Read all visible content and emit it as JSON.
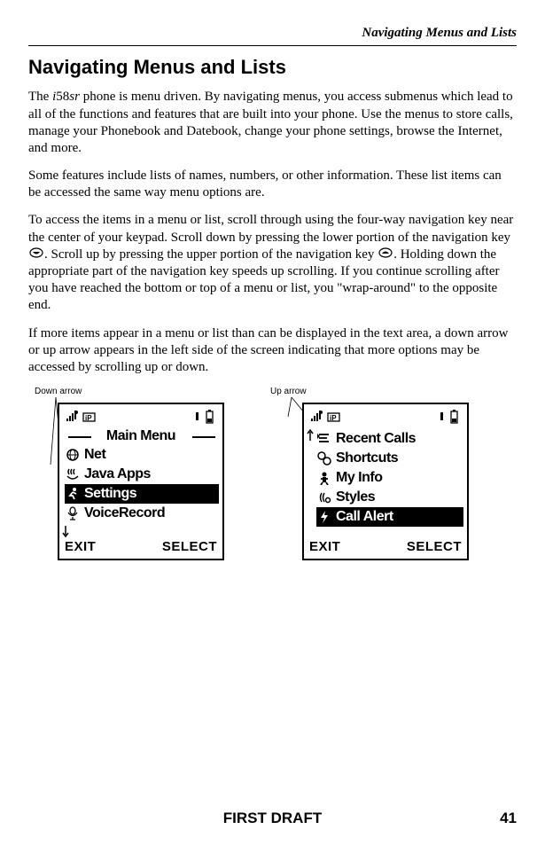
{
  "running_head": "Navigating Menus and Lists",
  "heading": "Navigating Menus and Lists",
  "para1_a": "The ",
  "para1_model": "i",
  "para1_model2": "58",
  "para1_model3": "sr",
  "para1_b": " phone is menu driven. By navigating menus, you access submenus which lead to all of the functions and features that are built into your phone. Use the menus to store calls, manage your Phonebook and Datebook, change your phone settings, browse the Internet, and more.",
  "para2": "Some features include lists of names, numbers, or other information. These list items can be accessed the same way menu options are.",
  "para3_a": "To access the items in a menu or list, scroll through using the four-way navigation key near the center of your keypad. Scroll down by pressing the lower portion of the navigation key ",
  "para3_b": ". Scroll up by pressing the upper portion of the navigation key ",
  "para3_c": ". Holding down the appropriate part of the navigation key speeds up scrolling. If you continue scrolling after you have reached the bottom or top of a menu or list, you \"wrap-around\" to the opposite end.",
  "para4": "If more items appear in a menu or list than can be displayed in the text area, a down arrow or up arrow appears in the left side of the screen indicating that more options may be accessed by scrolling up or down.",
  "fig1": {
    "label": "Down arrow",
    "title": "Main Menu",
    "items": [
      {
        "icon": "globe",
        "label": "Net",
        "selected": false
      },
      {
        "icon": "steam",
        "label": "Java Apps",
        "selected": false
      },
      {
        "icon": "runner",
        "label": "Settings",
        "selected": true
      },
      {
        "icon": "mic",
        "label": "VoiceRecord",
        "selected": false
      }
    ],
    "left_softkey": "EXIT",
    "right_softkey": "SELECT"
  },
  "fig2": {
    "label": "Up arrow",
    "items": [
      {
        "icon": "list",
        "label": "Recent Calls",
        "selected": false
      },
      {
        "icon": "circles",
        "label": "Shortcuts",
        "selected": false
      },
      {
        "icon": "person",
        "label": "My Info",
        "selected": false
      },
      {
        "icon": "ring",
        "label": "Styles",
        "selected": false
      },
      {
        "icon": "bolt",
        "label": "Call Alert",
        "selected": true
      }
    ],
    "left_softkey": "EXIT",
    "right_softkey": "SELECT"
  },
  "footer": "FIRST DRAFT",
  "page": "41"
}
